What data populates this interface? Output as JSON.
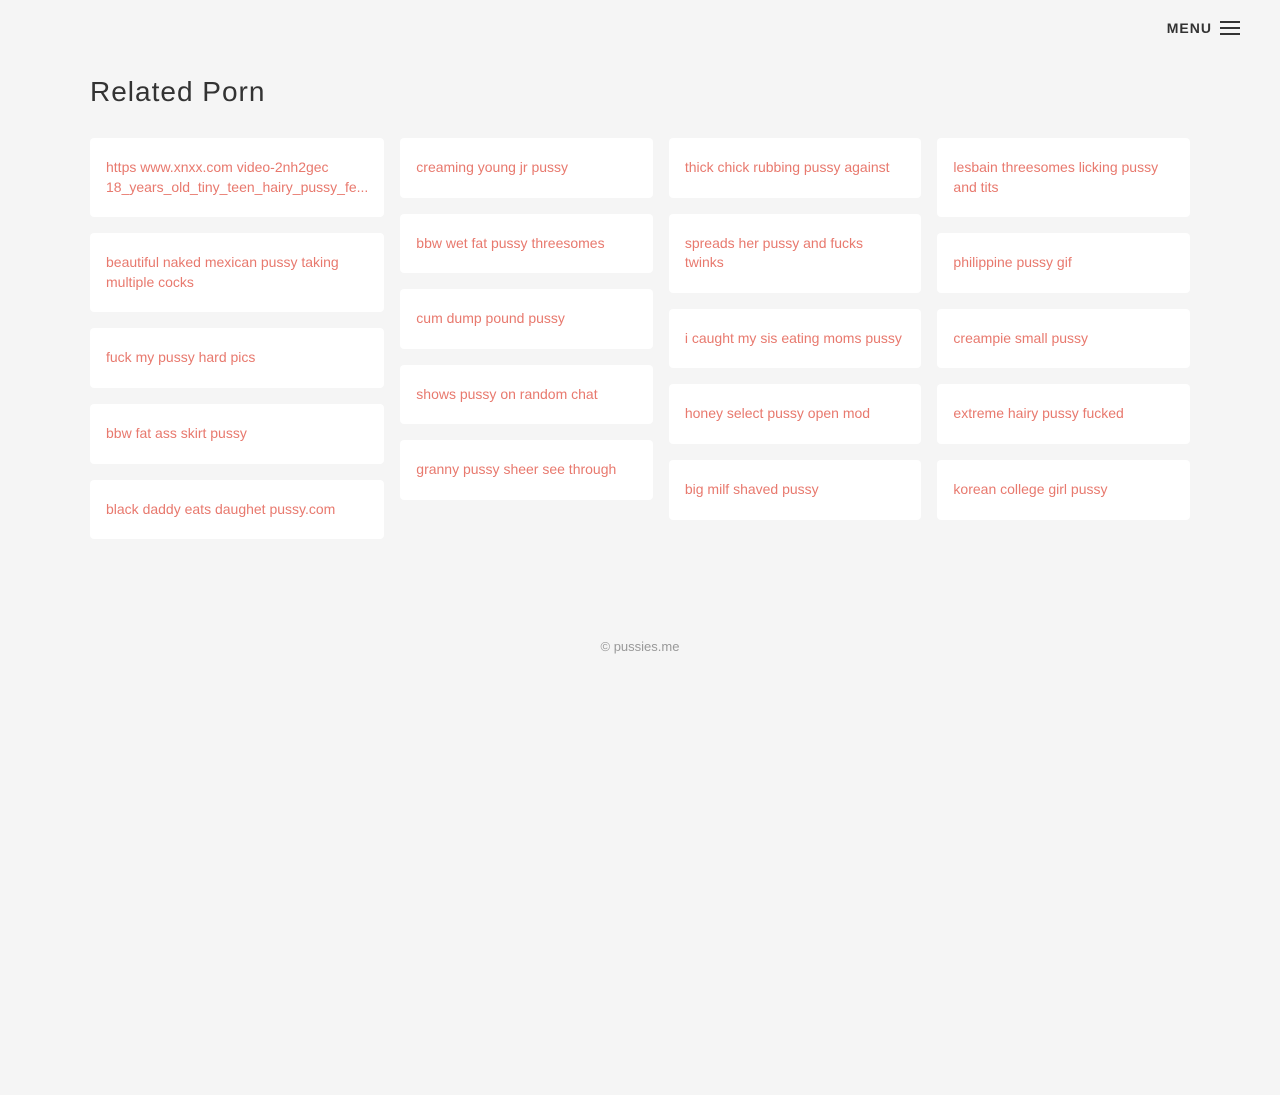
{
  "header": {
    "menu_label": "MENU"
  },
  "page": {
    "section_title": "Related Porn"
  },
  "columns": {
    "col1": [
      {
        "text": "https www.xnxx.com video-2nh2gec 18_years_old_tiny_teen_hairy_pussy_fe..."
      },
      {
        "text": "beautiful naked mexican pussy taking multiple cocks"
      },
      {
        "text": "fuck my pussy hard pics"
      },
      {
        "text": "bbw fat ass skirt pussy"
      },
      {
        "text": "black daddy eats daughet pussy.com"
      }
    ],
    "col2": [
      {
        "text": "creaming young jr pussy"
      },
      {
        "text": "bbw wet fat pussy threesomes"
      },
      {
        "text": "cum dump pound pussy"
      },
      {
        "text": "shows pussy on random chat"
      },
      {
        "text": "granny pussy sheer see through"
      }
    ],
    "col3": [
      {
        "text": "thick chick rubbing pussy against"
      },
      {
        "text": "spreads her pussy and fucks twinks"
      },
      {
        "text": "i caught my sis eating moms pussy"
      },
      {
        "text": "honey select pussy open mod"
      },
      {
        "text": "big milf shaved pussy"
      }
    ],
    "col4": [
      {
        "text": "lesbain threesomes licking pussy and tits"
      },
      {
        "text": "philippine pussy gif"
      },
      {
        "text": "creampie small pussy"
      },
      {
        "text": "extreme hairy pussy fucked"
      },
      {
        "text": "korean college girl pussy"
      }
    ]
  },
  "footer": {
    "copyright": "© pussies.me"
  }
}
